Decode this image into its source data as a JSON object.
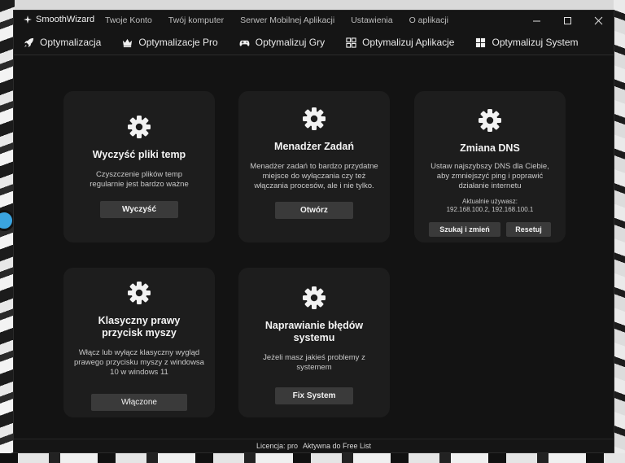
{
  "app": {
    "title": "SmoothWizard"
  },
  "menu": [
    "Twoje Konto",
    "Twój komputer",
    "Serwer Mobilnej Aplikacji",
    "Ustawienia",
    "O aplikacji"
  ],
  "nav": [
    {
      "label": "Optymalizacja",
      "icon": "rocket-icon"
    },
    {
      "label": "Optymalizacje Pro",
      "icon": "crown-icon"
    },
    {
      "label": "Optymalizuj Gry",
      "icon": "gamepad-icon"
    },
    {
      "label": "Optymalizuj Aplikacje",
      "icon": "apps-grid-icon"
    },
    {
      "label": "Optymalizuj System",
      "icon": "windows-logo-icon"
    }
  ],
  "cards": {
    "temp": {
      "title": "Wyczyść pliki temp",
      "desc": "Czyszczenie plików temp regularnie jest bardzo ważne",
      "button": "Wyczyść"
    },
    "tasks": {
      "title": "Menadżer Zadań",
      "desc": "Menadżer zadań to bardzo przydatne miejsce do wyłączania czy też włączania procesów, ale i nie tylko.",
      "button": "Otwórz"
    },
    "dns": {
      "title": "Zmiana DNS",
      "desc": "Ustaw najszybszy DNS dla Ciebie, aby zmniejszyć ping i poprawić działanie internetu",
      "current_label": "Aktualnie używasz:",
      "current_value": "192.168.100.2, 192.168.100.1",
      "button_primary": "Szukaj i zmień",
      "button_secondary": "Resetuj"
    },
    "mouse": {
      "title": "Klasyczny prawy przycisk myszy",
      "desc": "Włącz lub wyłącz klasyczny wygląd prawego przycisku myszy z windowsa 10 w windows 11",
      "button": "Włączone"
    },
    "repair": {
      "title": "Naprawianie błędów systemu",
      "desc": "Jeżeli masz jakieś problemy z systemem",
      "button": "Fix System"
    }
  },
  "status": {
    "license_label": "Licencja: pro",
    "license_value": "Aktywna do Free List"
  }
}
